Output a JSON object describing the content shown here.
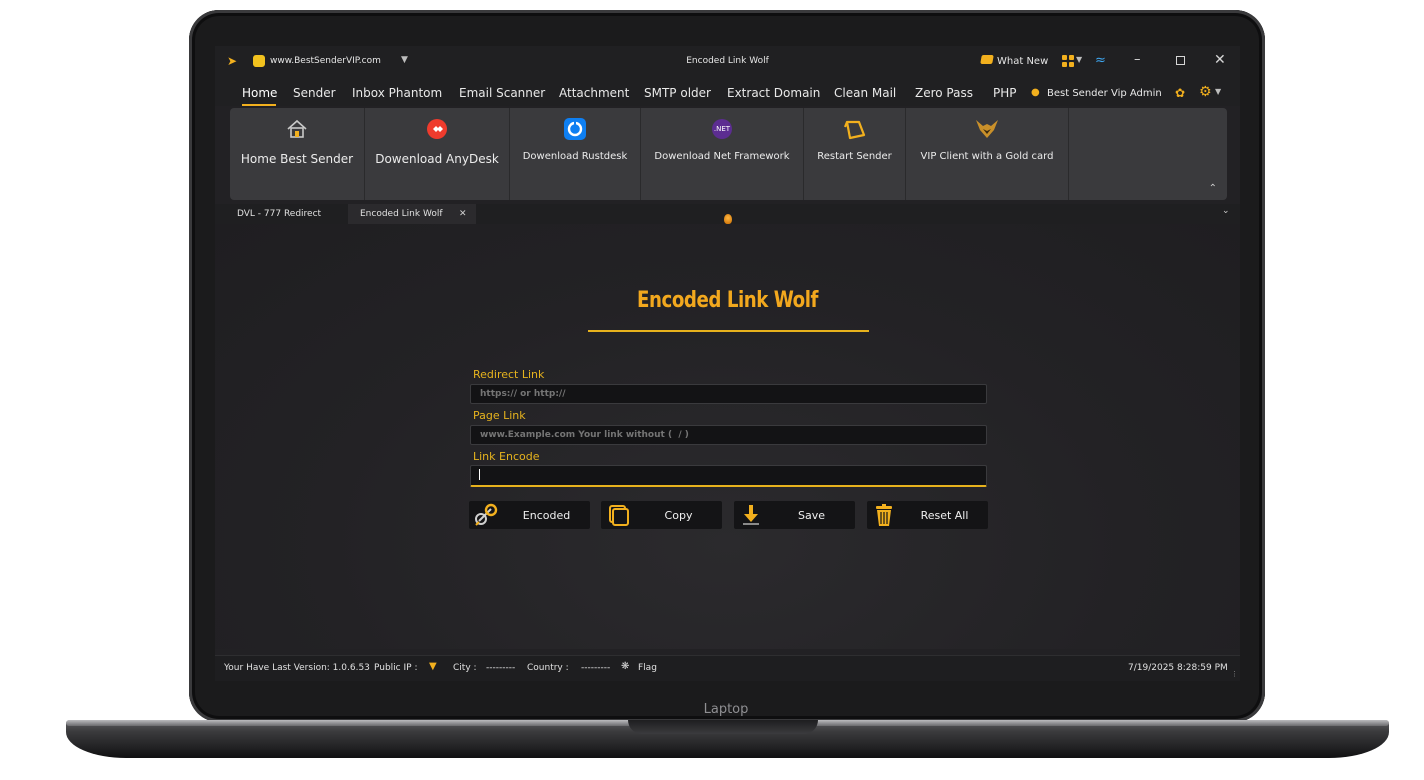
{
  "device": {
    "label": "Laptop"
  },
  "titlebar": {
    "site": "www.BestSenderVIP.com",
    "title": "Encoded Link Wolf",
    "whats_new": "What New"
  },
  "menu": {
    "items": [
      "Home",
      "Sender",
      "Inbox Phantom",
      "Email Scanner",
      "Attachment",
      "SMTP older",
      "Extract Domain",
      "Clean Mail",
      "Zero Pass",
      "PHP"
    ],
    "user": "Best Sender Vip Admin"
  },
  "ribbon": {
    "buttons": [
      {
        "label": "Home Best Sender",
        "icon": "house-icon"
      },
      {
        "label": "Dowenload AnyDesk",
        "icon": "anydesk-icon"
      },
      {
        "label": "Dowenload Rustdesk",
        "icon": "rustdesk-icon"
      },
      {
        "label": "Dowenload Net Framework",
        "icon": "dotnet-icon"
      },
      {
        "label": "Restart Sender",
        "icon": "restart-icon"
      },
      {
        "label": "VIP Client with a Gold card",
        "icon": "wolf-icon"
      }
    ],
    "dotnet_badge": ".NET"
  },
  "tabs": [
    {
      "label": "DVL - 777 Redirect"
    },
    {
      "label": "Encoded Link Wolf"
    }
  ],
  "form": {
    "title": "Encoded Link Wolf",
    "redirect_label": "Redirect Link",
    "redirect_placeholder": "https:// or http://",
    "page_label": "Page Link",
    "page_placeholder": "www.Example.com Your link without (  / )",
    "encode_label": "Link Encode",
    "encode_value": ""
  },
  "actions": {
    "encoded": "Encoded",
    "copy": "Copy",
    "save": "Save",
    "reset": "Reset All"
  },
  "status": {
    "version": "Your Have Last Version: 1.0.6.53",
    "public_ip": "Public IP :",
    "city_label": "City :",
    "city_value": "---------",
    "country_label": "Country :",
    "country_value": "---------",
    "flag": "Flag",
    "datetime": "7/19/2025 8:28:59 PM"
  },
  "colors": {
    "accent": "#f2b01e",
    "background": "#222124",
    "field": "#131315"
  }
}
